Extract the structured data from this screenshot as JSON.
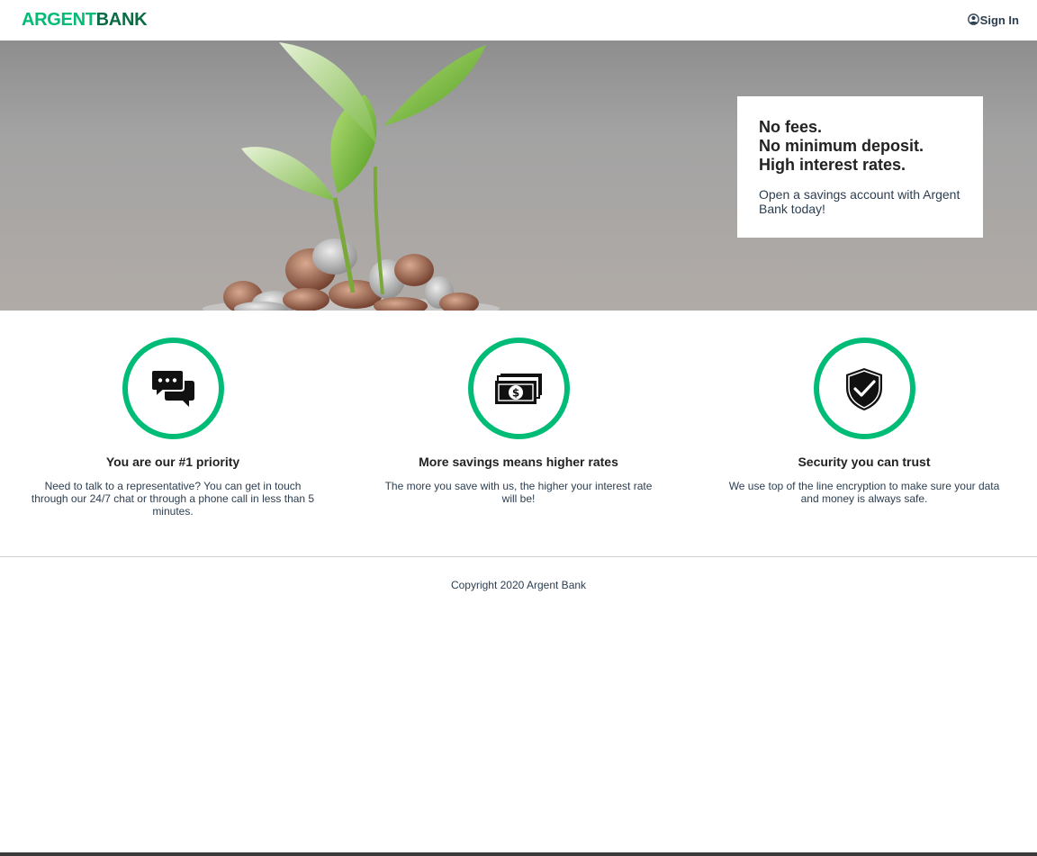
{
  "brand": {
    "name_part1": "ARGENT",
    "name_part2": "BANK",
    "accent": "#00bc77",
    "dark": "#0a6b45"
  },
  "nav": {
    "signin_label": "Sign In",
    "signin_icon": "user-circle-icon"
  },
  "hero": {
    "lines": [
      "No fees.",
      "No minimum deposit.",
      "High interest rates."
    ],
    "text": "Open a savings account with Argent Bank today!"
  },
  "features": [
    {
      "icon": "chat-icon",
      "title": "You are our #1 priority",
      "text": "Need to talk to a representative? You can get in touch through our 24/7 chat or through a phone call in less than 5 minutes."
    },
    {
      "icon": "money-icon",
      "title": "More savings means higher rates",
      "text": "The more you save with us, the higher your interest rate will be!"
    },
    {
      "icon": "security-icon",
      "title": "Security you can trust",
      "text": "We use top of the line encryption to make sure your data and money is always safe."
    }
  ],
  "footer": {
    "copyright": "Copyright 2020 Argent Bank"
  }
}
